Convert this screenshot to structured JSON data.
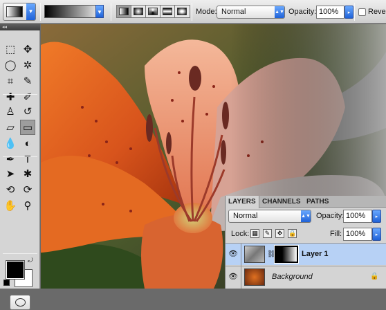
{
  "options_bar": {
    "mode_label": "Mode:",
    "mode_value": "Normal",
    "opacity_label": "Opacity:",
    "opacity_value": "100%",
    "reverse_label": "Reverse",
    "reverse_checked": false,
    "gradient_types": [
      "linear-gradient-icon",
      "radial-gradient-icon",
      "angle-gradient-icon",
      "reflected-gradient-icon",
      "diamond-gradient-icon"
    ],
    "active_gradient_type": 0
  },
  "tools": {
    "header": "◂◂",
    "items": [
      {
        "name": "marquee-icon",
        "glyph": "⬚"
      },
      {
        "name": "move-icon",
        "glyph": "✥"
      },
      {
        "name": "lasso-icon",
        "glyph": "◯"
      },
      {
        "name": "magic-wand-icon",
        "glyph": "✲"
      },
      {
        "name": "crop-icon",
        "glyph": "⌗"
      },
      {
        "name": "eyedropper-icon",
        "glyph": "✎"
      },
      {
        "name": "healing-brush-icon",
        "glyph": "✚"
      },
      {
        "name": "brush-icon",
        "glyph": "✐"
      },
      {
        "name": "clone-stamp-icon",
        "glyph": "♙"
      },
      {
        "name": "history-brush-icon",
        "glyph": "↺"
      },
      {
        "name": "eraser-icon",
        "glyph": "▱"
      },
      {
        "name": "gradient-icon",
        "glyph": "▭"
      },
      {
        "name": "blur-icon",
        "glyph": "💧"
      },
      {
        "name": "dodge-icon",
        "glyph": "◐"
      },
      {
        "name": "pen-icon",
        "glyph": "✒"
      },
      {
        "name": "type-icon",
        "glyph": "T"
      },
      {
        "name": "path-selection-icon",
        "glyph": "➤"
      },
      {
        "name": "shape-icon",
        "glyph": "✱"
      },
      {
        "name": "3d-rotate-icon",
        "glyph": "⟲"
      },
      {
        "name": "3d-orbit-icon",
        "glyph": "⟳"
      },
      {
        "name": "hand-icon",
        "glyph": "✋"
      },
      {
        "name": "zoom-icon",
        "glyph": "⚲"
      }
    ],
    "active_tool": "gradient-icon",
    "foreground_color": "#000000",
    "background_color": "#ffffff"
  },
  "layers_panel": {
    "tabs": [
      "LAYERS",
      "CHANNELS",
      "PATHS"
    ],
    "active_tab": 0,
    "blend_mode": "Normal",
    "opacity_label": "Opacity:",
    "opacity_value": "100%",
    "lock_label": "Lock:",
    "fill_label": "Fill:",
    "fill_value": "100%",
    "layers": [
      {
        "name": "Layer 1",
        "selected": true,
        "has_mask": true
      },
      {
        "name": "Background",
        "selected": false,
        "locked": true
      }
    ]
  }
}
